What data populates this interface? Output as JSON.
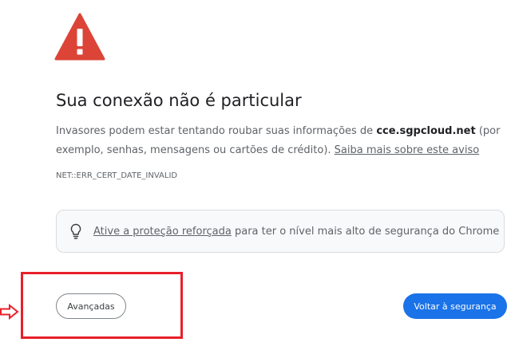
{
  "interstitial": {
    "title": "Sua conexão não é particular",
    "description_before": "Invasores podem estar tentando roubar suas informações de ",
    "host": "cce.sgpcloud.net",
    "description_after": " (por exemplo, senhas, mensagens ou cartões de crédito). ",
    "learn_more_link": "Saiba mais sobre este aviso",
    "error_code": "NET::ERR_CERT_DATE_INVALID",
    "enhanced_protection_link": "Ative a proteção reforçada",
    "enhanced_protection_text": " para ter o nível mais alto de segurança do Chrome"
  },
  "buttons": {
    "advanced_label": "Avançadas",
    "back_label": "Voltar à segurança"
  },
  "icons": {
    "warning": "warning-triangle-icon",
    "bulb": "lightbulb-icon",
    "arrow": "arrow-right-icon"
  },
  "colors": {
    "warning_red": "#db4437",
    "primary_blue": "#1a73e8",
    "annotation_red": "#e8202a"
  }
}
